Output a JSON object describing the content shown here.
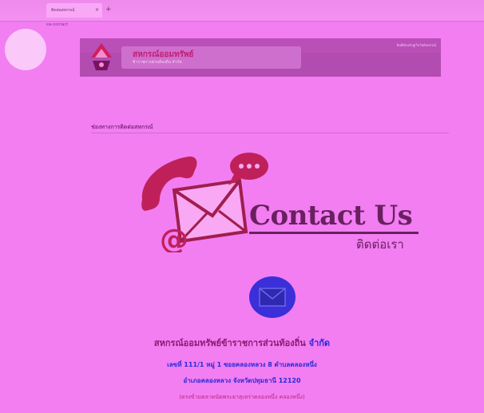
{
  "browser": {
    "tab_title": "ติดต่อสหกรณ์",
    "tab_close": "×",
    "new_tab": "+",
    "url": "sw-contact"
  },
  "banner": {
    "org_name": "สหกรณ์ออมทรัพย์",
    "org_sub": "ข้าราชการส่วนท้องถิ่น จำกัด",
    "right_text": "ยินดีต้อนรับสู่เว็บไซต์สหกรณ์"
  },
  "section": {
    "title": "ช่องทางการติดต่อสหกรณ์"
  },
  "contact": {
    "title": "Contact Us",
    "subtitle": "ติดต่อเรา"
  },
  "org": {
    "name": "สหกรณ์ออมทรัพย์ข้าราชการส่วนท้องถิ่น",
    "suffix": "จำกัด",
    "address1": "เลขที่ 111/1 หมู่ 1 ซอยคลองหลวง 8 ตำบลคลองหนึ่ง",
    "address2": "อำเภอคลองหลวง จังหวัดปทุมธานี 12120",
    "note": "(ตรงข้ามตลาดนัดพระยาสุเหร่าคลองหนึ่ง คลองหนึ่ง)"
  },
  "colors": {
    "background": "#f27ef2",
    "banner": "#b24cb0",
    "accent_blue": "#2a2ad8",
    "accent_red": "#c0205a"
  }
}
